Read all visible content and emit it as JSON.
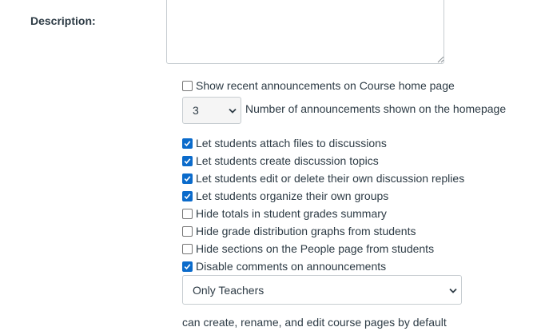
{
  "description": {
    "label": "Description:",
    "value": ""
  },
  "announcements": {
    "show_recent_label": "Show recent announcements on Course home page",
    "show_recent_checked": false,
    "count_value": "3",
    "count_label": "Number of announcements shown on the homepage"
  },
  "options": [
    {
      "label": "Let students attach files to discussions",
      "checked": true
    },
    {
      "label": "Let students create discussion topics",
      "checked": true
    },
    {
      "label": "Let students edit or delete their own discussion replies",
      "checked": true
    },
    {
      "label": "Let students organize their own groups",
      "checked": true
    },
    {
      "label": "Hide totals in student grades summary",
      "checked": false
    },
    {
      "label": "Hide grade distribution graphs from students",
      "checked": false
    },
    {
      "label": "Hide sections on the People page from students",
      "checked": false
    },
    {
      "label": "Disable comments on announcements",
      "checked": true
    }
  ],
  "pages_editing": {
    "selected": "Only Teachers",
    "note": "can create, rename, and edit course pages by default"
  },
  "colors": {
    "checkbox_checked": "#0b6bcb",
    "text": "#2d3b45",
    "border": "#c7cdd1"
  }
}
